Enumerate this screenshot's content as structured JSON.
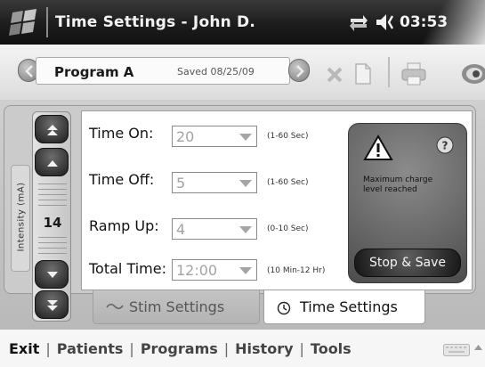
{
  "titlebar": {
    "title": "Time Settings - John D.",
    "time": "03:53",
    "icons": [
      "windows-logo-icon",
      "connection-icon",
      "volume-icon"
    ]
  },
  "toolbar": {
    "program_name": "Program A",
    "saved_label": "Saved 08/25/09",
    "icons": [
      "chevron-left-icon",
      "chevron-right-icon",
      "close-icon",
      "document-icon",
      "print-icon",
      "eye-icon"
    ]
  },
  "intensity": {
    "label": "Intensity (mA)",
    "value": "14",
    "icons": [
      "double-chevron-up-icon",
      "chevron-up-icon",
      "chevron-down-icon",
      "double-chevron-down-icon"
    ]
  },
  "settings": {
    "rows": [
      {
        "label": "Time On:",
        "value": "20",
        "hint": "(1-60 Sec)"
      },
      {
        "label": "Time Off:",
        "value": "5",
        "hint": "(1-60 Sec)"
      },
      {
        "label": "Ramp Up:",
        "value": "4",
        "hint": "(0-10 Sec)"
      },
      {
        "label": "Total Time:",
        "value": "12:00",
        "hint": "(10 Min-12 Hr)"
      }
    ]
  },
  "warning": {
    "message": "Maximum charge level reached",
    "stop_save_label": "Stop & Save",
    "icons": [
      "warning-icon",
      "help-icon"
    ]
  },
  "tabs": [
    {
      "label": "Stim Settings",
      "icon": "wave-icon",
      "active": false
    },
    {
      "label": "Time Settings",
      "icon": "clock-icon",
      "active": true
    }
  ],
  "bottom_menu": {
    "exit": "Exit",
    "patients": "Patients",
    "programs": "Programs",
    "history": "History",
    "tools": "Tools",
    "separator": "|",
    "icons": [
      "keyboard-icon",
      "caret-up-icon"
    ]
  },
  "colors": {
    "titlebar": "#1c1c1c",
    "panel": "#c4c4c4",
    "button_dark": "#1d1d1d"
  }
}
